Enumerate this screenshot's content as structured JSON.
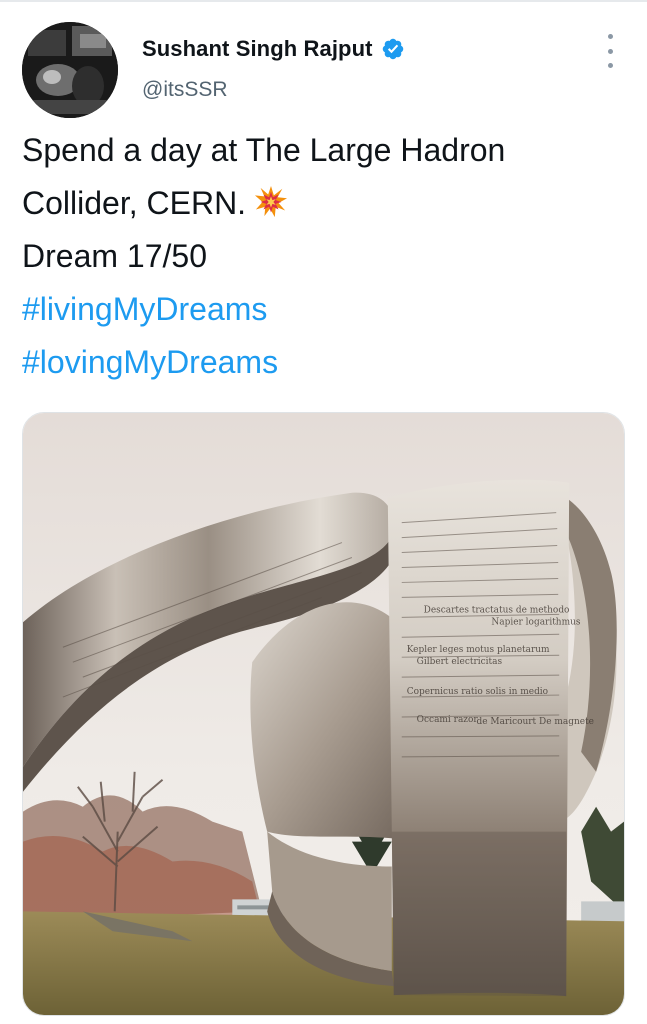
{
  "tweet": {
    "author": {
      "display_name": "Sushant Singh Rajput",
      "handle": "@itsSSR",
      "verified": true,
      "avatar_icon": "profile-photo"
    },
    "text_lines": [
      "Spend a day at The Large Hadron",
      "Collider, CERN.",
      "Dream 17/50"
    ],
    "emoji_icon": "collision-icon",
    "hashtags": [
      "#livingMyDreams",
      "#lovingMyDreams"
    ],
    "media": {
      "type": "photo",
      "sculpture_text": [
        "Descartes tractatus de methodo",
        "Napier logarithmus",
        "Kepler leges motus planetarum",
        "Gilbert electricitas",
        "Copernicus ratio solis in medio",
        "Occami razor",
        "de Maricourt De magnete"
      ]
    }
  },
  "colors": {
    "text": "#0f1419",
    "secondary": "#536471",
    "link": "#1d9bf0",
    "verified": "#1d9bf0"
  }
}
